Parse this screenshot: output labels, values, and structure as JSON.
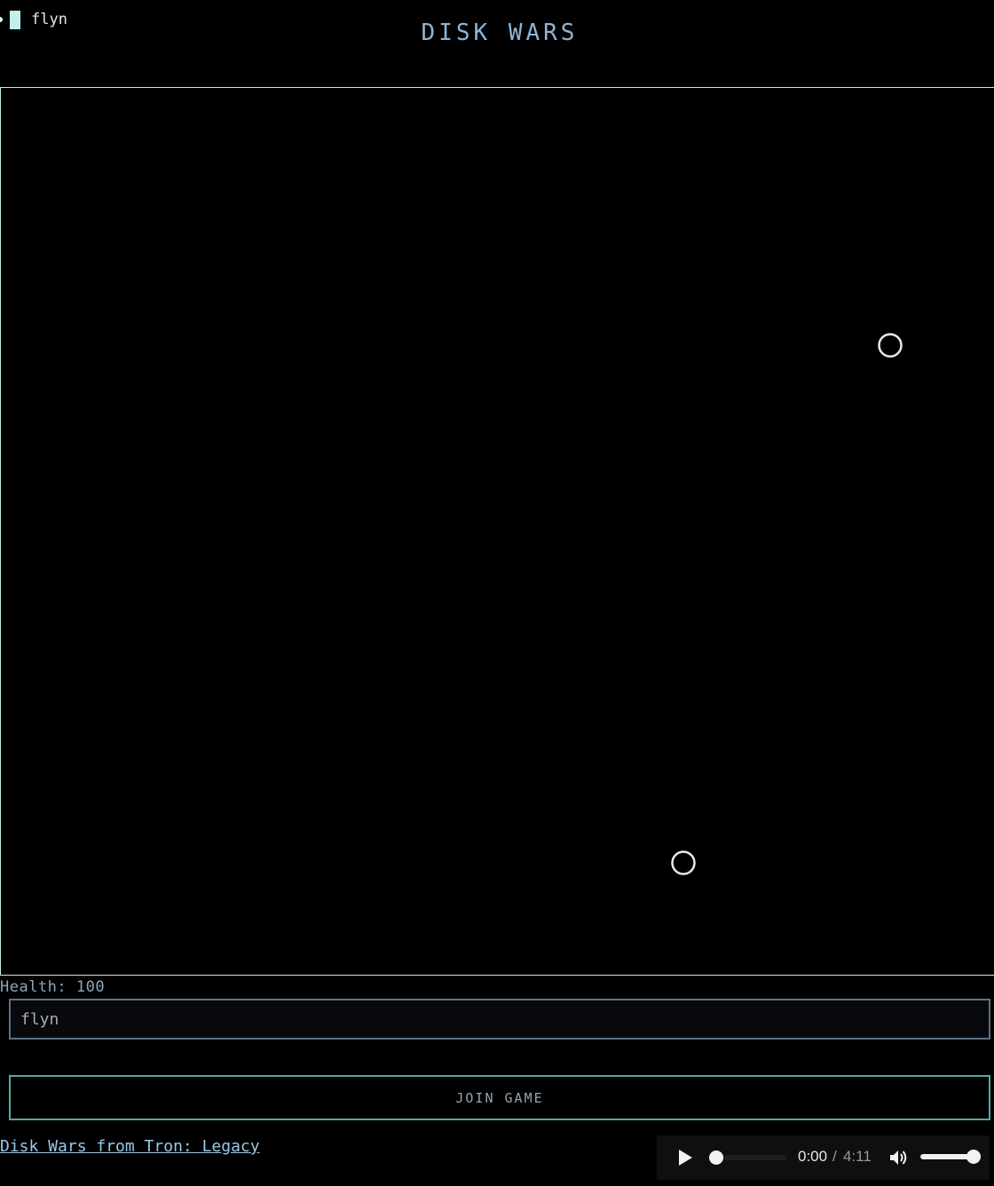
{
  "header": {
    "player_name": "flyn",
    "player_color": "#bff0ee",
    "title": "DISK WARS"
  },
  "arena": {
    "border_color": "#bdeeea",
    "disk_color": "#e8e8e8",
    "disks": [
      {
        "id": "disk-1"
      },
      {
        "id": "disk-2"
      }
    ]
  },
  "status": {
    "health_label": "Health: 100"
  },
  "form": {
    "name_value": "flyn",
    "join_label": "JOIN GAME"
  },
  "footer": {
    "credit_link": "Disk Wars from Tron: Legacy"
  },
  "audio": {
    "current_time": "0:00",
    "separator": "/",
    "total_time": "4:11",
    "progress": 0,
    "volume": 1,
    "play_icon": "play-icon",
    "volume_icon": "volume-icon"
  }
}
